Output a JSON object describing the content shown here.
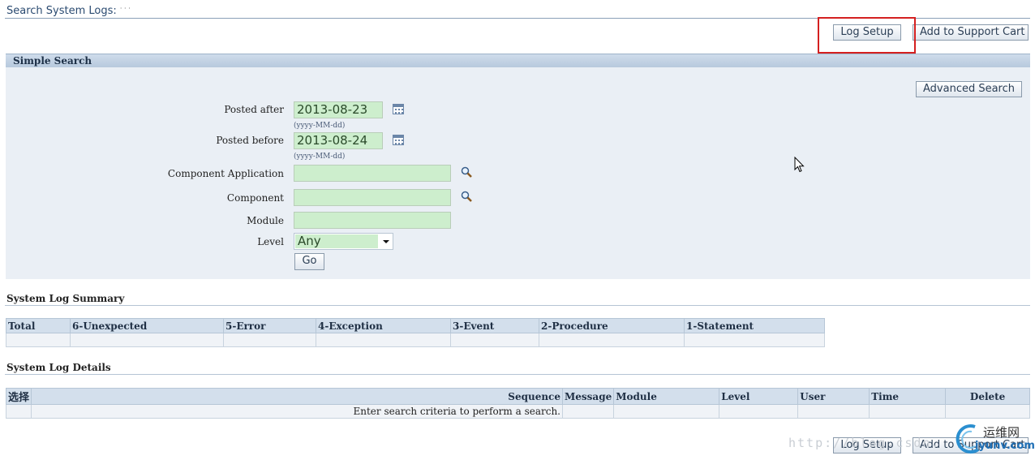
{
  "page": {
    "title": "Search System Logs:",
    "title_suffix": "·  ·  ·"
  },
  "toolbar": {
    "log_setup_label": "Log Setup",
    "add_to_cart_label": "Add to Support Cart",
    "highlight_color": "#d42020"
  },
  "simple_search": {
    "header": "Simple Search",
    "advanced_search_label": "Advanced Search",
    "posted_after": {
      "label": "Posted after",
      "value": "2013-08-23",
      "hint": "(yyyy-MM-dd)"
    },
    "posted_before": {
      "label": "Posted before",
      "value": "2013-08-24",
      "hint": "(yyyy-MM-dd)"
    },
    "component_application": {
      "label": "Component Application",
      "value": ""
    },
    "component": {
      "label": "Component",
      "value": ""
    },
    "module": {
      "label": "Module",
      "value": ""
    },
    "level": {
      "label": "Level",
      "selected": "Any"
    },
    "go_label": "Go"
  },
  "summary": {
    "header": "System Log Summary",
    "columns": [
      "Total",
      "6-Unexpected",
      "5-Error",
      "4-Exception",
      "3-Event",
      "2-Procedure",
      "1-Statement"
    ]
  },
  "details": {
    "header": "System Log Details",
    "columns": [
      "选择",
      "Sequence",
      "Message",
      "Module",
      "Level",
      "User",
      "Time",
      "Delete"
    ],
    "empty_message": "Enter search criteria to perform a search."
  },
  "footer": {
    "log_setup_label": "Log Setup",
    "add_to_cart_label": "Add to Support Cart",
    "watermark": "http://blog.csdn.",
    "logo_text": "运维网",
    "logo_sub": "iyunv.com"
  },
  "colors": {
    "field_bg": "#cdeecd",
    "panel_bg": "#eaeff5",
    "header_bar": "#b7c9dd"
  }
}
